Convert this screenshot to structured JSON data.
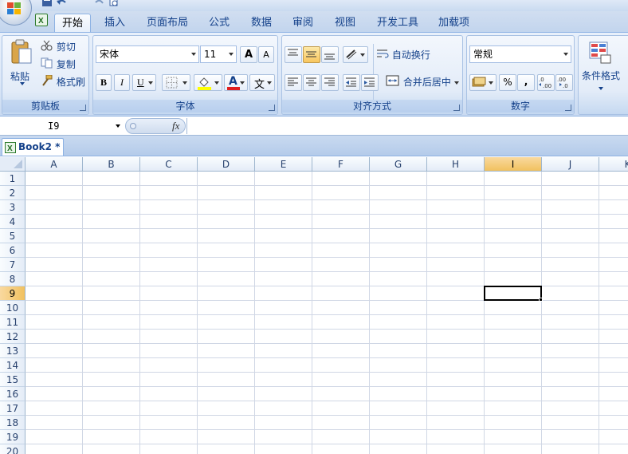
{
  "tabs": [
    "开始",
    "插入",
    "页面布局",
    "公式",
    "数据",
    "审阅",
    "视图",
    "开发工具",
    "加载项"
  ],
  "active_tab": "开始",
  "clipboard": {
    "paste_label": "粘贴",
    "cut_label": "剪切",
    "copy_label": "复制",
    "format_painter_label": "格式刷",
    "group_label": "剪贴板"
  },
  "font": {
    "font_name": "宋体",
    "font_size": "11",
    "bold": "B",
    "italic": "I",
    "underline": "U",
    "font_color_glyph": "A",
    "phonetic_glyph": "文",
    "grow_glyph": "A",
    "shrink_glyph": "A",
    "group_label": "字体"
  },
  "alignment": {
    "wrap_text_label": "自动换行",
    "merge_center_label": "合并后居中",
    "group_label": "对齐方式"
  },
  "number": {
    "format_value": "常规",
    "percent_glyph": "%",
    "comma_glyph": ",",
    "group_label": "数字"
  },
  "styles": {
    "conditional_format_label": "条件格式"
  },
  "formula_bar": {
    "name_box_value": "I9",
    "fx_label": "fx",
    "formula_value": ""
  },
  "workbook": {
    "tab_label": "Book2 *"
  },
  "sheet": {
    "columns": [
      "A",
      "B",
      "C",
      "D",
      "E",
      "F",
      "G",
      "H",
      "I",
      "J",
      "K"
    ],
    "rows": [
      "1",
      "2",
      "3",
      "4",
      "5",
      "6",
      "7",
      "8",
      "9",
      "10",
      "11",
      "12",
      "13",
      "14",
      "15",
      "16",
      "17",
      "18",
      "19",
      "20"
    ],
    "selected_column": "I",
    "selected_row": "9"
  },
  "colors": {
    "accent": "#15428b",
    "selection_header": "#f1c15f",
    "gridline": "#d0d7e5"
  }
}
